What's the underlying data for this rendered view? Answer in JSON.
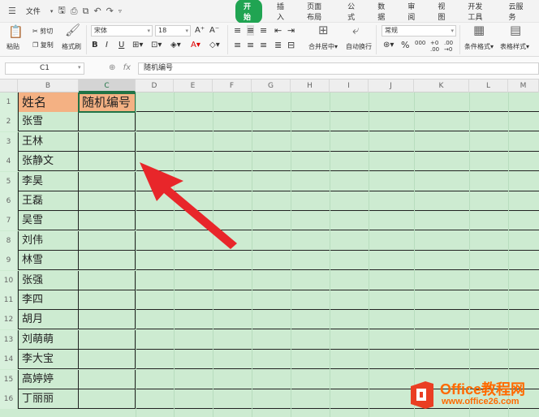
{
  "menu": {
    "file": "文件",
    "tabs": [
      "开始",
      "插入",
      "页面布局",
      "公式",
      "数据",
      "审阅",
      "视图",
      "开发工具",
      "云服务"
    ],
    "active_tab": "开始"
  },
  "ribbon": {
    "paste": "粘贴",
    "cut": "剪切",
    "copy": "复制",
    "format_painter": "格式刷",
    "font_name": "宋体",
    "font_size": "18",
    "bold": "B",
    "italic": "I",
    "underline": "U",
    "merge_center": "合并居中",
    "wrap_text": "自动换行",
    "number_format": "常规",
    "percent": "%",
    "thousands": "000",
    "cond_format": "条件格式",
    "table_style": "表格样式"
  },
  "formula_bar": {
    "cell_ref": "C1",
    "fx": "fx",
    "content": "随机编号"
  },
  "sheet": {
    "columns": [
      "B",
      "C",
      "D",
      "E",
      "F",
      "G",
      "H",
      "I",
      "J",
      "K",
      "L",
      "M"
    ],
    "selected_column": "C",
    "header": {
      "row": "1",
      "name": "姓名",
      "id": "随机编号"
    },
    "rows": [
      {
        "row": "2",
        "name": "张雪"
      },
      {
        "row": "3",
        "name": "王林"
      },
      {
        "row": "4",
        "name": "张静文"
      },
      {
        "row": "5",
        "name": "李昊"
      },
      {
        "row": "6",
        "name": "王磊"
      },
      {
        "row": "7",
        "name": "吴雪"
      },
      {
        "row": "8",
        "name": "刘伟"
      },
      {
        "row": "9",
        "name": "林雪"
      },
      {
        "row": "10",
        "name": "张强"
      },
      {
        "row": "11",
        "name": "李四"
      },
      {
        "row": "12",
        "name": "胡月"
      },
      {
        "row": "13",
        "name": "刘萌萌"
      },
      {
        "row": "14",
        "name": "李大宝"
      },
      {
        "row": "15",
        "name": "高婷婷"
      },
      {
        "row": "16",
        "name": "丁丽丽"
      }
    ]
  },
  "watermark": {
    "title": "Office教程网",
    "url": "www.office26.com"
  },
  "colors": {
    "accent": "#20a452",
    "header_fill": "#f4b183",
    "sheet_bg": "#cdebd1",
    "arrow": "#e8262a",
    "watermark": "#ff6a00"
  }
}
